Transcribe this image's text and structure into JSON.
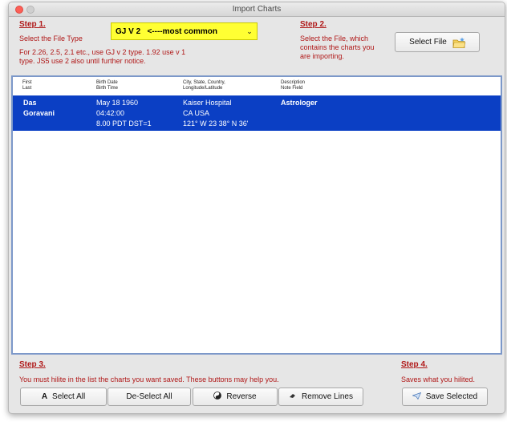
{
  "window": {
    "title": "Import Charts"
  },
  "step1": {
    "title": "Step 1.",
    "instruction": "Select the File Type",
    "help_line1": "For 2.26, 2.5, 2.1 etc., use GJ v 2 type. 1.92 use v 1",
    "help_line2": "type. JS5 use 2 also until further notice.",
    "file_type_value": "GJ V 2   <----most common"
  },
  "step2": {
    "title": "Step 2.",
    "line1": "Select the File, which",
    "line2": "contains the charts you",
    "line3": "are importing.",
    "select_file_label": "Select File"
  },
  "list": {
    "headers": [
      {
        "line1": "First",
        "line2": "Last"
      },
      {
        "line1": "Birth Date",
        "line2": "Birth Time"
      },
      {
        "line1": "City, State, Country,",
        "line2": "Longitude/Latitude"
      },
      {
        "line1": "Description",
        "line2": "Note Field"
      }
    ],
    "rows": [
      {
        "first": "Das",
        "last": "Goravani",
        "birth_date": "May 18 1960",
        "birth_time": "04:42:00",
        "zone": "8.00  PDT  DST=1",
        "city": "Kaiser Hospital",
        "state_country": "CA  USA",
        "coords": "121° W 23  38° N 36'",
        "description": "Astrologer"
      }
    ]
  },
  "step3": {
    "title": "Step 3.",
    "instruction": "You must hilite in the list the charts you want saved. These buttons may help you.",
    "select_all_label": "Select All",
    "deselect_all_label": "De-Select All",
    "reverse_label": "Reverse",
    "remove_lines_label": "Remove Lines"
  },
  "step4": {
    "title": "Step 4.",
    "instruction": "Saves what you hilited.",
    "save_selected_label": "Save Selected"
  },
  "colors": {
    "step_red": "#b01818",
    "selector_yellow": "#ffff33",
    "selection_blue": "#0b3fc4",
    "list_border": "#7c98c9"
  },
  "icons": {
    "select_file": "folder-sparkle-icon",
    "select_all": "text-a-icon",
    "reverse": "yin-yang-icon",
    "remove_lines": "eraser-icon",
    "save_selected": "paper-plane-icon"
  }
}
